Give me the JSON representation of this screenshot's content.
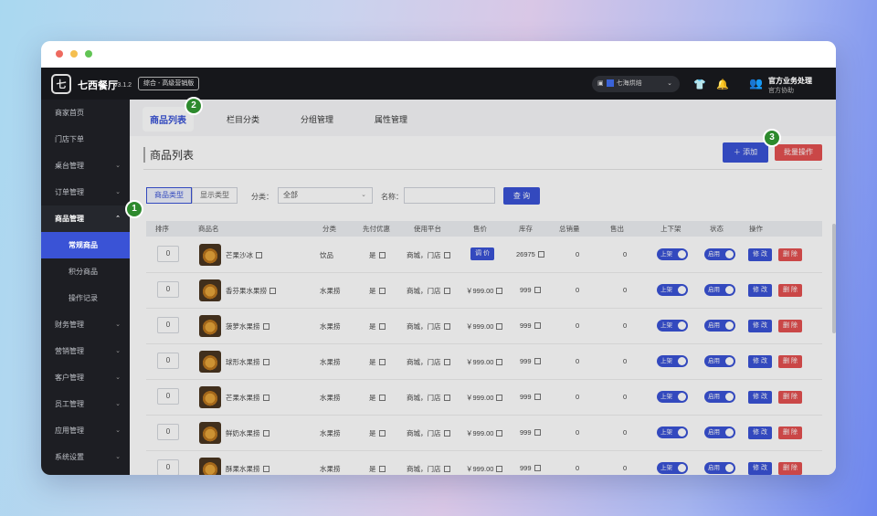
{
  "topbar": {
    "brand": "七西餐厅",
    "version": "v3.1.2",
    "edition": "综合 - 高级营销版",
    "store": "七海烘焙",
    "user_name": "官方业务处理",
    "user_sub": "官方协助"
  },
  "sidebar": {
    "items": [
      {
        "label": "商家首页",
        "chevron": false
      },
      {
        "label": "门店下单",
        "chevron": false
      },
      {
        "label": "桌台管理",
        "chevron": true
      },
      {
        "label": "订单管理",
        "chevron": true
      },
      {
        "label": "商品管理",
        "chevron": true,
        "open": true
      }
    ],
    "subitems": [
      "常规商品",
      "积分商品",
      "操作记录"
    ],
    "more_items": [
      "财务管理",
      "营销管理",
      "客户管理",
      "员工管理",
      "应用管理",
      "系统设置"
    ]
  },
  "tabs": [
    "商品列表",
    "栏目分类",
    "分组管理",
    "属性管理"
  ],
  "page": {
    "title": "商品列表",
    "add_label": "＋ 添加",
    "batch_label": "批量操作"
  },
  "filters": {
    "seg": [
      "商品类型",
      "显示类型"
    ],
    "category_label": "分类：",
    "category_value": "全部",
    "name_label": "名称：",
    "query_label": "查 询"
  },
  "table": {
    "headers": [
      "排序",
      "商品名",
      "分类",
      "先付优惠",
      "使用平台",
      "售价",
      "库存",
      "总销量",
      "售出",
      "上下架",
      "状态",
      "操作"
    ],
    "rows": [
      {
        "sort": "0",
        "name": "芒果沙冰",
        "category": "饮品",
        "prepay": "是",
        "platform": "商城，门店",
        "price": "调 价",
        "stock": "26975",
        "total": "0",
        "sold": "0"
      },
      {
        "sort": "0",
        "name": "香芬果水果捞",
        "category": "水果捞",
        "prepay": "是",
        "platform": "商城，门店",
        "price": "￥999.00",
        "stock": "999",
        "total": "0",
        "sold": "0"
      },
      {
        "sort": "0",
        "name": "菠萝水果捞",
        "category": "水果捞",
        "prepay": "是",
        "platform": "商城，门店",
        "price": "￥999.00",
        "stock": "999",
        "total": "0",
        "sold": "0"
      },
      {
        "sort": "0",
        "name": "球形水果捞",
        "category": "水果捞",
        "prepay": "是",
        "platform": "商城，门店",
        "price": "￥999.00",
        "stock": "999",
        "total": "0",
        "sold": "0"
      },
      {
        "sort": "0",
        "name": "芒果水果捞",
        "category": "水果捞",
        "prepay": "是",
        "platform": "商城，门店",
        "price": "￥999.00",
        "stock": "999",
        "total": "0",
        "sold": "0"
      },
      {
        "sort": "0",
        "name": "鲜奶水果捞",
        "category": "水果捞",
        "prepay": "是",
        "platform": "商城，门店",
        "price": "￥999.00",
        "stock": "999",
        "total": "0",
        "sold": "0"
      },
      {
        "sort": "0",
        "name": "酥果水果捞",
        "category": "水果捞",
        "prepay": "是",
        "platform": "商城，门店",
        "price": "￥999.00",
        "stock": "999",
        "total": "0",
        "sold": "0"
      }
    ],
    "toggle_shelf": "上架",
    "toggle_status": "启用",
    "edit_label": "修 改",
    "delete_label": "删 除"
  },
  "badges": [
    "1",
    "2",
    "3"
  ],
  "colors": {
    "accent": "#3a53d6",
    "danger": "#e35050",
    "sidebar": "#1d1e23",
    "badge": "#2d8a2d"
  }
}
